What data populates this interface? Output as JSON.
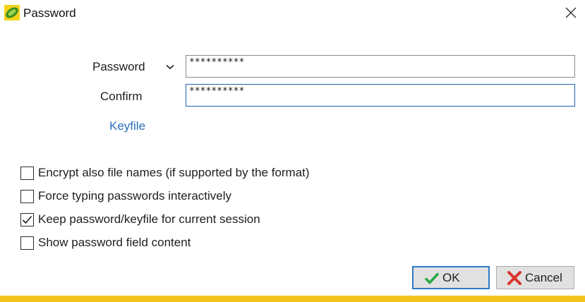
{
  "window": {
    "title": "Password",
    "icon": "peazip-leaf-icon",
    "close_icon": "close-icon"
  },
  "form": {
    "password_label": "Password",
    "password_value": "**********",
    "history_dropdown_icon": "chevron-down-icon",
    "confirm_label": "Confirm",
    "confirm_value": "**********",
    "keyfile_link": "Keyfile"
  },
  "options": [
    {
      "label": "Encrypt also file names (if supported by the format)",
      "checked": false
    },
    {
      "label": "Force typing passwords interactively",
      "checked": false
    },
    {
      "label": "Keep password/keyfile for current session",
      "checked": true
    },
    {
      "label": "Show password field content",
      "checked": false
    }
  ],
  "buttons": {
    "ok_label": "OK",
    "ok_icon": "checkmark-icon",
    "cancel_label": "Cancel",
    "cancel_icon": "x-icon"
  },
  "colors": {
    "accent_bar": "#f2c31b",
    "link": "#2a6ebb",
    "focus_border": "#1c64b4",
    "ok_check": "#2aa845",
    "cancel_x": "#d9342b"
  }
}
